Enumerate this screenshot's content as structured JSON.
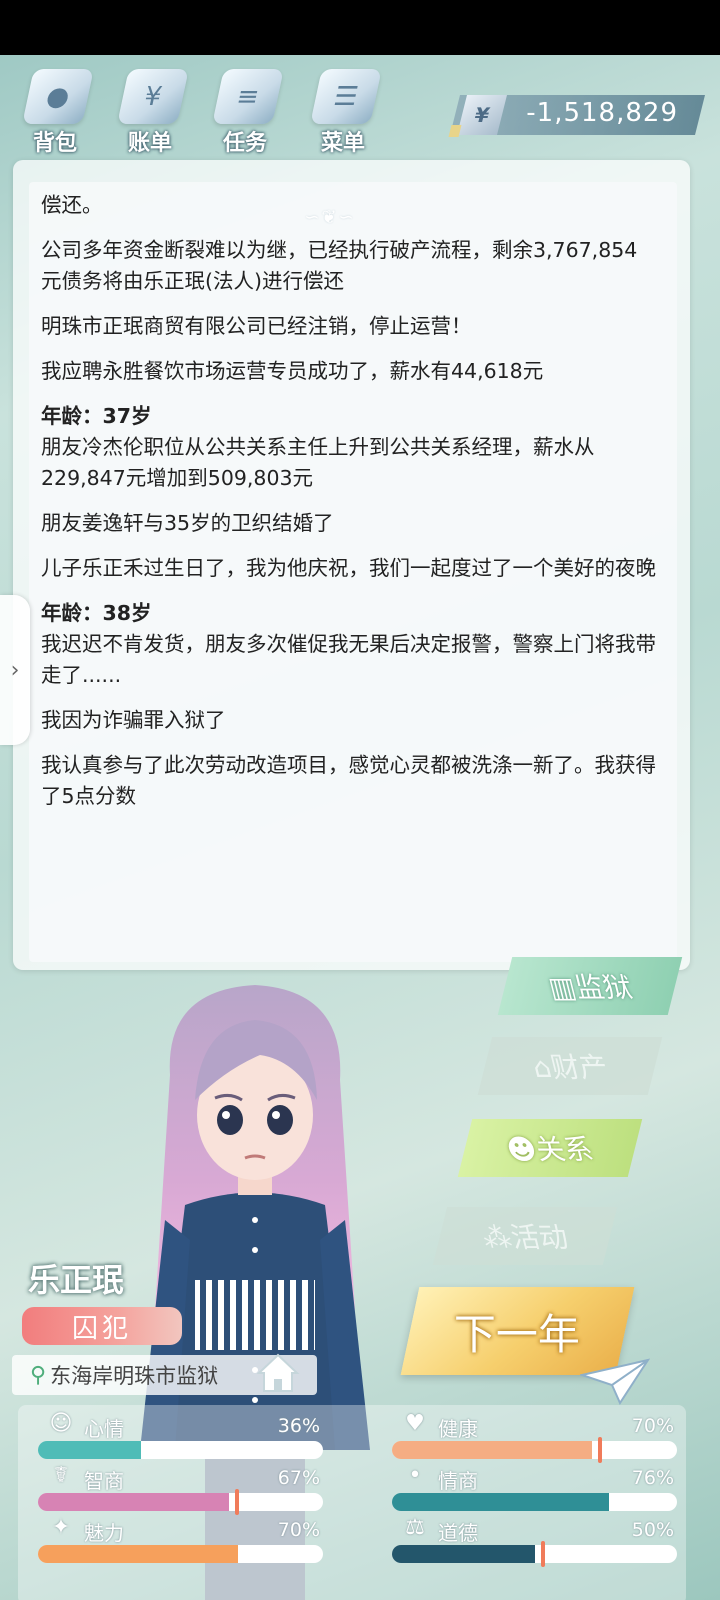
{
  "toolbar": {
    "items": [
      {
        "label": "背包",
        "icon": "bag-icon"
      },
      {
        "label": "账单",
        "icon": "bill-icon"
      },
      {
        "label": "任务",
        "icon": "task-icon"
      },
      {
        "label": "菜单",
        "icon": "menu-icon"
      }
    ],
    "money_symbol": "¥",
    "money": "-1,518,829"
  },
  "log": [
    {
      "type": "text",
      "text": "偿还。"
    },
    {
      "type": "text",
      "text": "公司多年资金断裂难以为继，已经执行破产流程，剩余3,767,854元债务将由乐正珉(法人)进行偿还"
    },
    {
      "type": "text",
      "text": "明珠市正珉商贸有限公司已经注销，停止运营！"
    },
    {
      "type": "text",
      "text": "我应聘永胜餐饮市场运营专员成功了，薪水有44,618元"
    },
    {
      "type": "age",
      "text": "年龄：37岁"
    },
    {
      "type": "text",
      "text": "朋友冷杰伦职位从公共关系主任上升到公共关系经理，薪水从229,847元增加到509,803元"
    },
    {
      "type": "text",
      "text": "朋友姜逸轩与35岁的卫织结婚了"
    },
    {
      "type": "text",
      "text": "儿子乐正禾过生日了，我为他庆祝，我们一起度过了一个美好的夜晚"
    },
    {
      "type": "age",
      "text": "年龄：38岁"
    },
    {
      "type": "text",
      "text": "我迟迟不肯发货，朋友多次催促我无果后决定报警，警察上门将我带走了......"
    },
    {
      "type": "text",
      "text": "我因为诈骗罪入狱了"
    },
    {
      "type": "text",
      "text": "我认真参与了此次劳动改造项目，感觉心灵都被洗涤一新了。我获得了5点分数"
    }
  ],
  "actions": {
    "prison": "监狱",
    "property": "财产",
    "relation": "关系",
    "activity": "活动",
    "next_year": "下一年"
  },
  "character": {
    "name": "乐正珉",
    "role": "囚犯",
    "location": "东海岸明珠市监狱"
  },
  "stats": [
    {
      "label": "心情",
      "icon": "smile-icon",
      "value": 36,
      "display": "36%",
      "color": "#4fbcb7"
    },
    {
      "label": "健康",
      "icon": "heart-icon",
      "value": 70,
      "display": "70%",
      "color": "#f5ad83"
    },
    {
      "label": "智商",
      "icon": "brain-icon",
      "value": 67,
      "display": "67%",
      "color": "#d783b4"
    },
    {
      "label": "情商",
      "icon": "apple-icon",
      "value": 76,
      "display": "76%",
      "color": "#2f8f96"
    },
    {
      "label": "魅力",
      "icon": "star-icon",
      "value": 70,
      "display": "70%",
      "color": "#f6a05c"
    },
    {
      "label": "道德",
      "icon": "scale-icon",
      "value": 50,
      "display": "50%",
      "color": "#23566b"
    }
  ]
}
